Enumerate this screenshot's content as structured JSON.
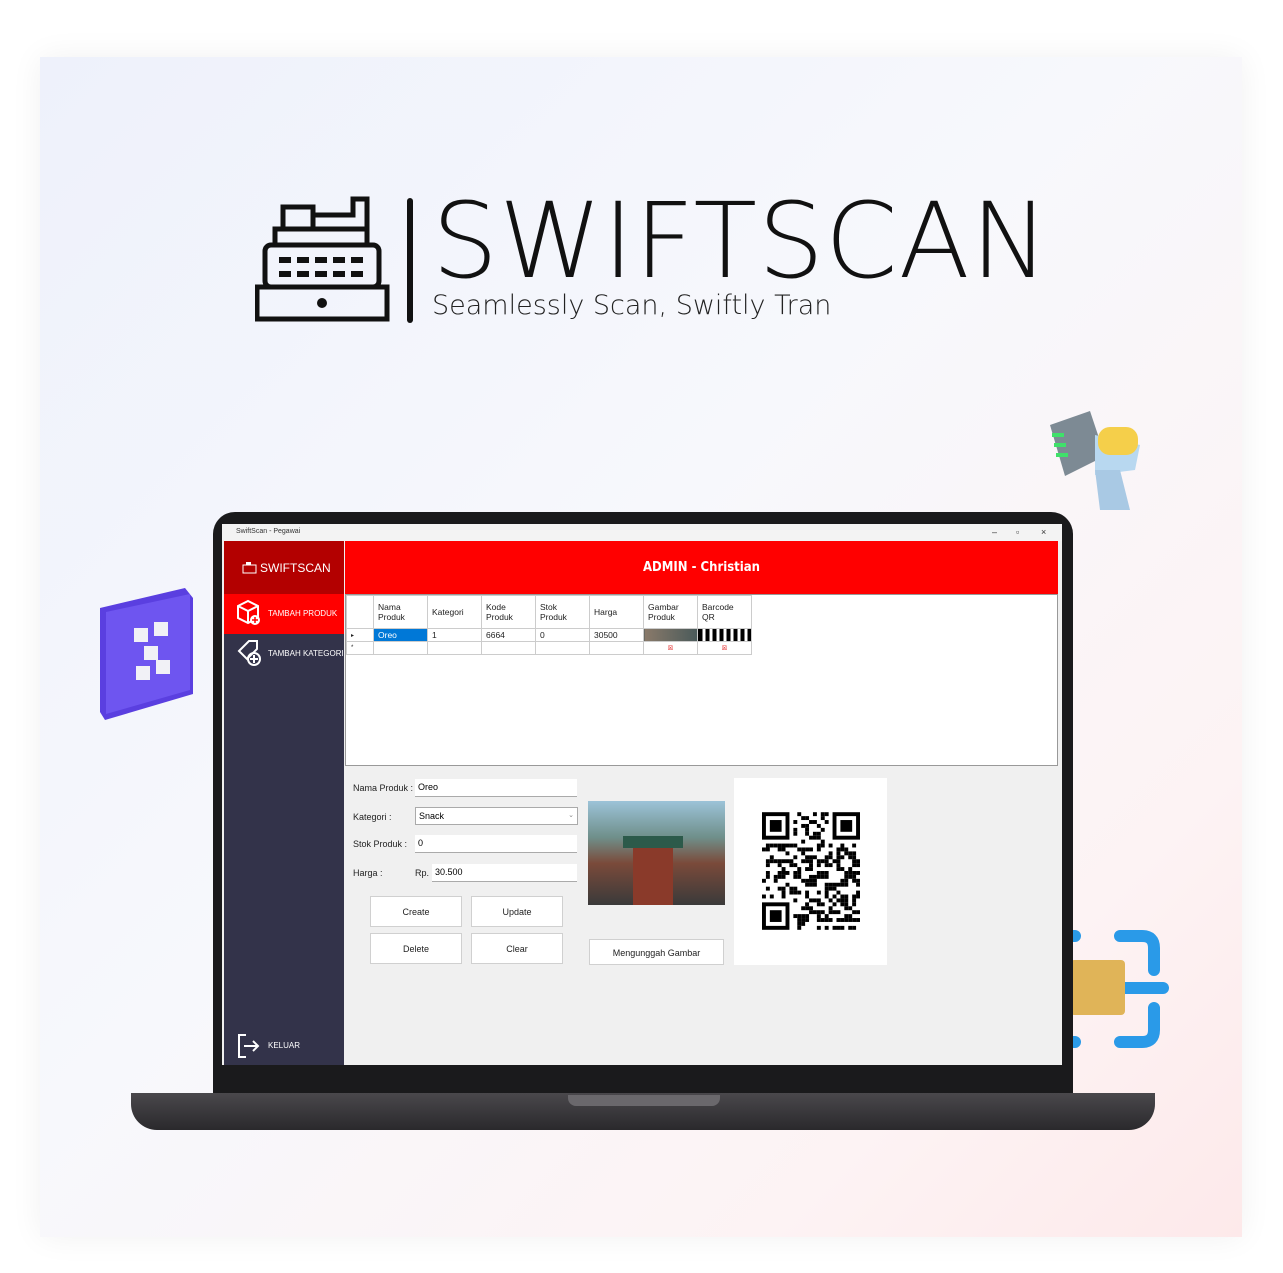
{
  "hero": {
    "brand": "SWIFTSCAN",
    "tagline": "Seamlessly Scan, Swiftly Tran"
  },
  "window": {
    "title": "SwiftScan - Pegawai",
    "minimize": "–",
    "restore": "▫",
    "close": "×"
  },
  "sidebar": {
    "logo": "SWIFTSCAN",
    "items": [
      {
        "label": "TAMBAH PRODUK",
        "icon": "box-add-icon",
        "active": true
      },
      {
        "label": "TAMBAH KATEGORI",
        "icon": "tag-add-icon"
      }
    ],
    "logout": "KELUAR"
  },
  "header": {
    "title": "ADMIN - Christian"
  },
  "table": {
    "columns": [
      "Nama Produk",
      "Kategori",
      "Kode Produk",
      "Stok Produk",
      "Harga",
      "Gambar Produk",
      "Barcode QR"
    ],
    "rows": [
      [
        "Oreo",
        "1",
        "6664",
        "0",
        "30500",
        "",
        ""
      ]
    ]
  },
  "form": {
    "nama_label": "Nama Produk :",
    "nama_value": "Oreo",
    "kategori_label": "Kategori :",
    "kategori_value": "Snack",
    "stok_label": "Stok Produk :",
    "stok_value": "0",
    "harga_label": "Harga :",
    "currency": "Rp.",
    "harga_value": "30.500",
    "buttons": {
      "create": "Create",
      "update": "Update",
      "delete": "Delete",
      "clear": "Clear",
      "upload": "Mengunggah Gambar"
    }
  },
  "colors": {
    "accent": "#ff0000",
    "sidebar": "#33334a",
    "logo_bg": "#b30000"
  }
}
